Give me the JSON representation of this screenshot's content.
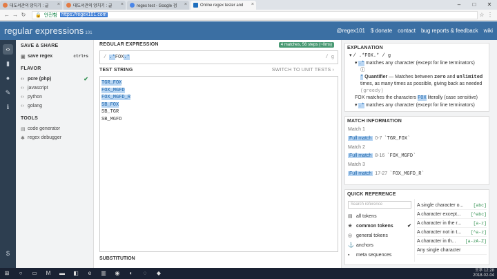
{
  "browser": {
    "tabs": [
      {
        "label": "대도서관의 앙치기 : 글",
        "icon": "blog-icon",
        "active": false
      },
      {
        "label": "대도서관의 앙치기 : 글",
        "icon": "blog-icon",
        "active": false
      },
      {
        "label": "regex test - Google 검",
        "icon": "google-icon",
        "active": false
      },
      {
        "label": "Online regex tester and",
        "icon": "regex101-icon",
        "active": true
      }
    ],
    "secure_label": "안전함",
    "url": "https://regex101.com"
  },
  "header": {
    "logo_main": "regular expressions",
    "logo_small": "101",
    "links": [
      "@regex101",
      "$ donate",
      "contact",
      "bug reports & feedback",
      "wiki"
    ]
  },
  "sidebar": {
    "save_share_title": "SAVE & SHARE",
    "save_label": "save regex",
    "save_shortcut": "ctrl+s",
    "flavor_title": "FLAVOR",
    "flavors": [
      "pcre (php)",
      "javascript",
      "python",
      "golang"
    ],
    "tools_title": "TOOLS",
    "tools": [
      "code generator",
      "regex debugger"
    ]
  },
  "editor": {
    "regex_title": "REGULAR EXPRESSION",
    "match_badge": "4 matches, 56 steps (~0ms)",
    "delim_open": "/",
    "regex_token1": ".*",
    "regex_literal": "FOX",
    "regex_token2": ".*",
    "delim_close": "/ g",
    "test_title": "TEST STRING",
    "switch_label": "SWITCH TO UNIT TESTS ›",
    "lines": [
      "TGR_FOX",
      "FOX_MGFD",
      "FOX_MGFD_R",
      "SB_FOX",
      "SB_TGR",
      "SB_MGFD"
    ],
    "substitution_title": "SUBSTITUTION"
  },
  "explanation": {
    "title": "EXPLANATION",
    "root": "/ .*FOX.* / g",
    "l1": "matches any character (except for line terminators)",
    "l2_bold": "Quantifier",
    "l2": "— Matches between",
    "l2_zero": "zero",
    "l2_and": "and",
    "l2_unl": "unlimited",
    "l2_rest": "times, as many times as possible, giving back as needed",
    "l2_greedy": "(greedy)",
    "l3_a": "FOX matches the characters",
    "l3_b": "FOX",
    "l3_c": "literally (case sensitive)",
    "l4": "matches any character (except for line terminators)"
  },
  "match_info": {
    "title": "MATCH INFORMATION",
    "matches": [
      {
        "num": "Match 1",
        "label": "Full match",
        "range": "0-7",
        "value": "`TGR_FOX`"
      },
      {
        "num": "Match 2",
        "label": "Full match",
        "range": "8-16",
        "value": "`FOX_MGFD`"
      },
      {
        "num": "Match 3",
        "label": "Full match",
        "range": "17-27",
        "value": "`FOX_MGFD_R`"
      }
    ]
  },
  "quick_ref": {
    "title": "QUICK REFERENCE",
    "search_placeholder": "Search reference",
    "categories": [
      "all tokens",
      "common tokens",
      "general tokens",
      "anchors",
      "meta sequences"
    ],
    "rows": [
      {
        "desc": "A single character o...",
        "code": "[abc]"
      },
      {
        "desc": "A character except...",
        "code": "[^abc]"
      },
      {
        "desc": "A character in the r...",
        "code": "[a-z]"
      },
      {
        "desc": "A character not in t...",
        "code": "[^a-z]"
      },
      {
        "desc": "A character in th...",
        "code": "[a-zA-Z]"
      },
      {
        "desc": "Any single character",
        "code": ""
      }
    ]
  },
  "taskbar": {
    "time": "오후 12:28",
    "date": "2018-02-04"
  }
}
